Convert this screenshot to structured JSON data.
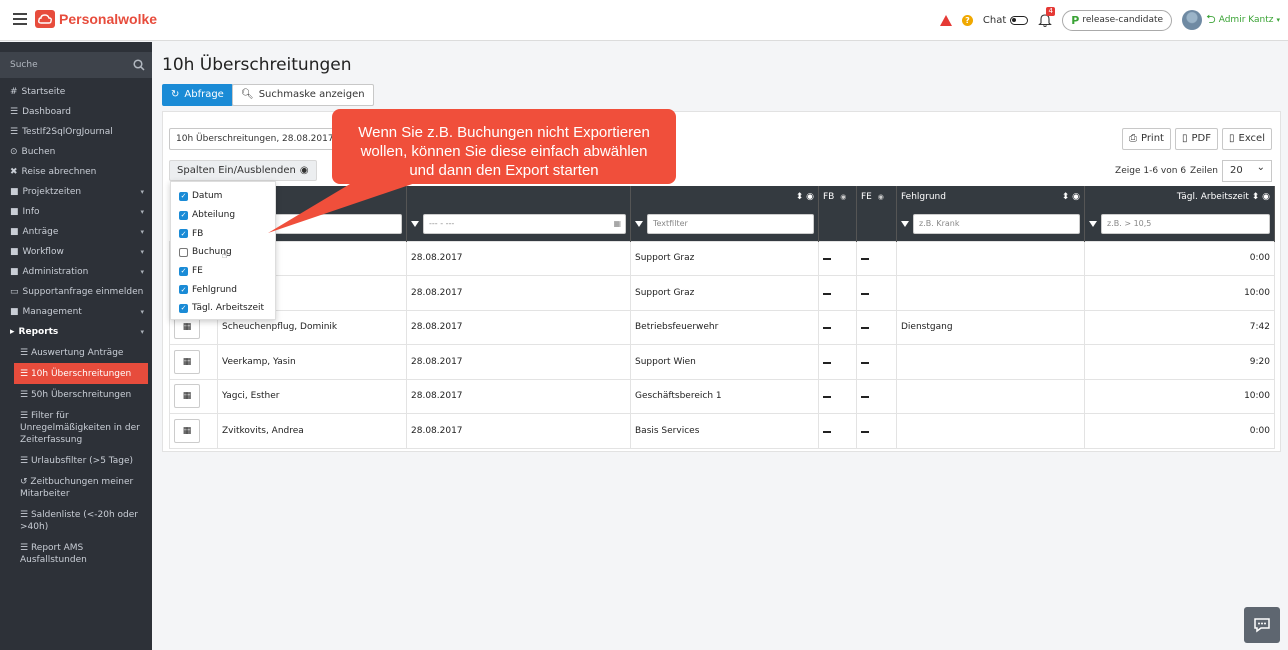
{
  "app": {
    "logo_text": "Personalwolke"
  },
  "topbar": {
    "chat_label": "Chat",
    "notification_count": "4",
    "release_label": "release-candidate",
    "user_name": "Admir Kantz"
  },
  "sidebar": {
    "search_placeholder": "Suche",
    "items": [
      {
        "label": "Startseite",
        "icon": "#"
      },
      {
        "label": "Dashboard",
        "icon": "☰"
      },
      {
        "label": "TestIf2SqlOrgJournal",
        "icon": "☰"
      },
      {
        "label": "Buchen",
        "icon": "⊙"
      },
      {
        "label": "Reise abrechnen",
        "icon": "✖"
      },
      {
        "label": "Projektzeiten",
        "icon": "■"
      },
      {
        "label": "Info",
        "icon": "■"
      },
      {
        "label": "Anträge",
        "icon": "■"
      },
      {
        "label": "Workflow",
        "icon": "■"
      },
      {
        "label": "Administration",
        "icon": "■"
      },
      {
        "label": "Supportanfrage einmelden",
        "icon": "▭"
      },
      {
        "label": "Management",
        "icon": "■"
      },
      {
        "label": "Reports",
        "icon": "▸"
      }
    ],
    "reports_sub": [
      "Auswertung Anträge",
      "10h Überschreitungen",
      "50h Überschreitungen",
      "Filter für Unregelmäßigkeiten in der Zeiterfassung",
      "Urlaubsfilter (>5 Tage)",
      "Zeitbuchungen meiner Mitarbeiter",
      "Saldenliste (<-20h oder >40h)",
      "Report AMS Ausfallstunden"
    ]
  },
  "main": {
    "title": "10h Überschreitungen",
    "query_button": "Abfrage",
    "searchmask_button": "Suchmaske anzeigen",
    "report_select": "10h Überschreitungen, 28.08.2017 - 2",
    "columns_button": "Spalten Ein/Ausblenden",
    "export": {
      "print": "Print",
      "pdf": "PDF",
      "excel": "Excel"
    },
    "pagination_text": "Zeige 1-6 von 6",
    "rows_label": "Zeilen",
    "page_size": "20"
  },
  "callout": {
    "line1": "Wenn Sie z.B. Buchungen nicht Exportieren",
    "line2": "wollen, können Sie diese einfach abwählen",
    "line3": "und dann den Export starten"
  },
  "column_toggle": [
    {
      "label": "Datum",
      "checked": true
    },
    {
      "label": "Abteilung",
      "checked": true
    },
    {
      "label": "FB",
      "checked": true
    },
    {
      "label": "Buchung",
      "checked": false
    },
    {
      "label": "FE",
      "checked": true
    },
    {
      "label": "Fehlgrund",
      "checked": true
    },
    {
      "label": "Tägl. Arbeitszeit",
      "checked": true
    }
  ],
  "table": {
    "headers": {
      "fb": "FB",
      "fe": "FE",
      "fehlgrund": "Fehlgrund",
      "arbeitszeit": "Tägl. Arbeitszeit"
    },
    "filters": {
      "name_placeholder": "",
      "date_placeholder": "--- - ---",
      "dept_placeholder": "Textfilter",
      "fehlgrund_placeholder": "z.B. Krank",
      "arbeitszeit_placeholder": "z.B. > 10,5"
    },
    "rows": [
      {
        "name": "",
        "date": "28.08.2017",
        "dept": "Support Graz",
        "fehlgrund": "",
        "time": "0:00"
      },
      {
        "name": "",
        "date": "28.08.2017",
        "dept": "Support Graz",
        "fehlgrund": "",
        "time": "10:00"
      },
      {
        "name": "Scheuchenpflug, Dominik",
        "date": "28.08.2017",
        "dept": "Betriebsfeuerwehr",
        "fehlgrund": "Dienstgang",
        "time": "7:42"
      },
      {
        "name": "Veerkamp, Yasin",
        "date": "28.08.2017",
        "dept": "Support Wien",
        "fehlgrund": "",
        "time": "9:20"
      },
      {
        "name": "Yagci, Esther",
        "date": "28.08.2017",
        "dept": "Geschäftsbereich 1",
        "fehlgrund": "",
        "time": "10:00"
      },
      {
        "name": "Zvitkovits, Andrea",
        "date": "28.08.2017",
        "dept": "Basis Services",
        "fehlgrund": "",
        "time": "0:00"
      }
    ]
  },
  "colors": {
    "accent": "#e74c3c",
    "primary": "#1a8bd6",
    "callout": "#f04f3b",
    "sidebar": "#2d3138"
  }
}
